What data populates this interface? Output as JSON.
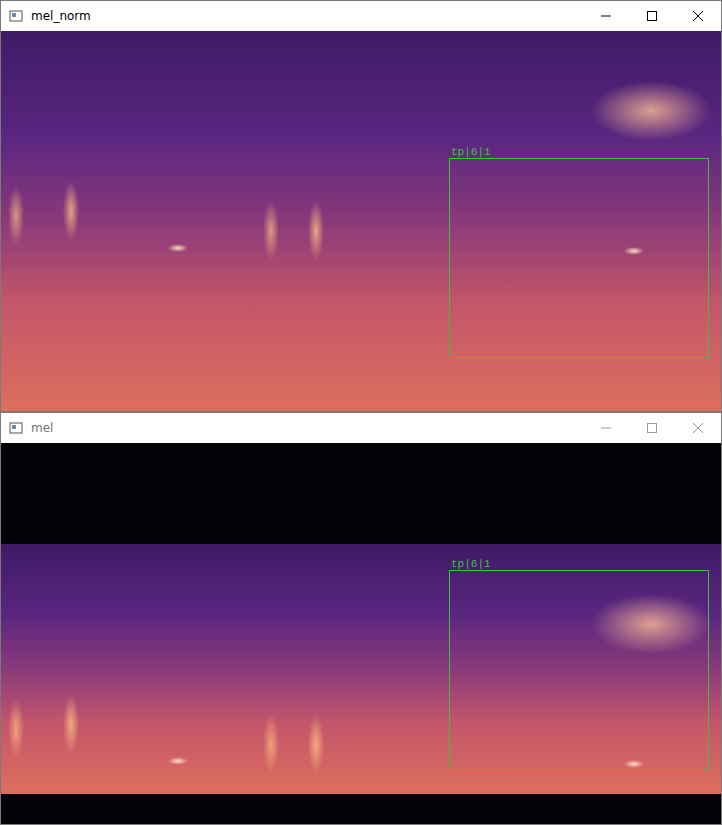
{
  "windows": [
    {
      "title": "mel_norm",
      "active": true,
      "kind": "normalized",
      "boxes": [
        {
          "label": "tp|6|1"
        }
      ]
    },
    {
      "title": "mel",
      "active": false,
      "kind": "padded",
      "boxes": [
        {
          "label": "tp|6|1"
        }
      ]
    }
  ]
}
